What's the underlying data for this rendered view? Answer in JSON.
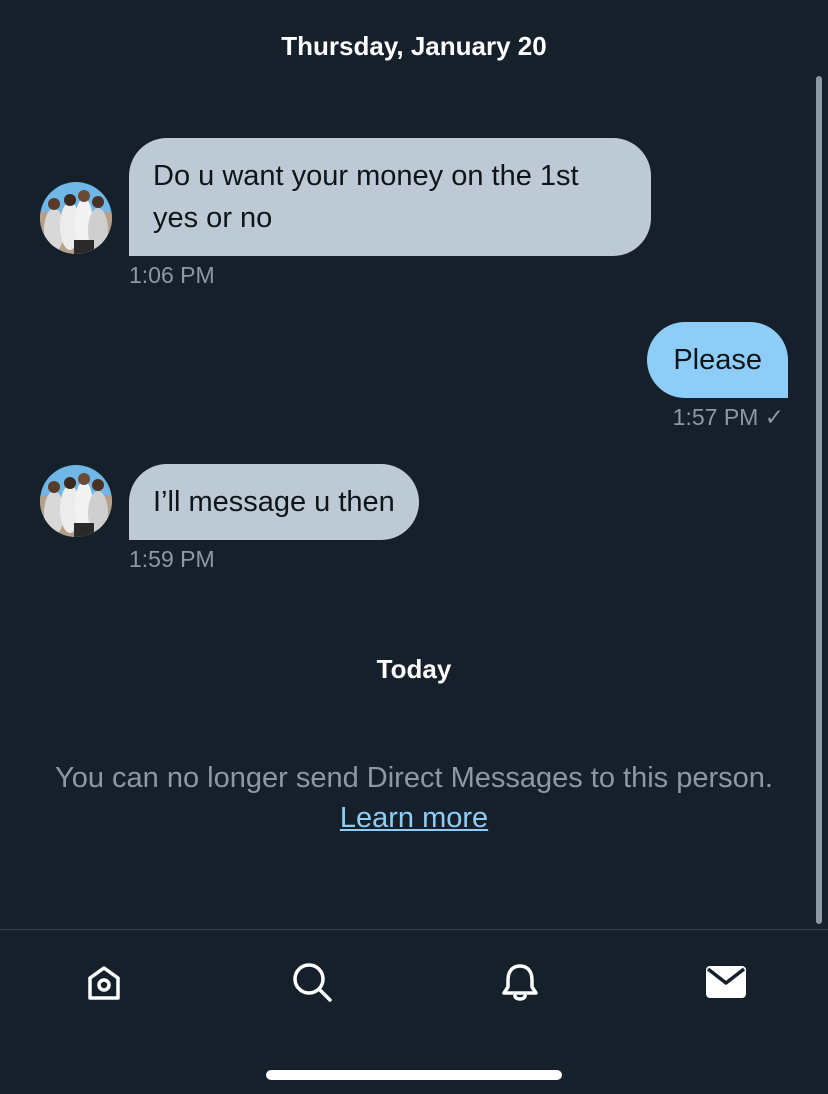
{
  "conversation": {
    "date_header": "Thursday, January 20",
    "messages": [
      {
        "direction": "incoming",
        "lines": [
          "Do u want your money on the 1st",
          "yes or no"
        ],
        "time": "1:06 PM"
      },
      {
        "direction": "outgoing",
        "lines": [
          "Please"
        ],
        "time": "1:57 PM ✓"
      },
      {
        "direction": "incoming",
        "lines": [
          "I’ll message u then"
        ],
        "time": "1:59 PM"
      }
    ],
    "today_header": "Today",
    "notice": {
      "text": "You can no longer send Direct Messages to this person.",
      "link": "Learn more"
    }
  },
  "tabbar": {
    "items": [
      {
        "icon": "home-icon",
        "active": false
      },
      {
        "icon": "search-icon",
        "active": false
      },
      {
        "icon": "notifications-bell-icon",
        "active": false
      },
      {
        "icon": "messages-mail-icon",
        "active": true
      }
    ]
  },
  "colors": {
    "background": "#15202b",
    "incoming_bubble": "#bdcad6",
    "outgoing_bubble": "#8ecdf8",
    "secondary_text": "#8b98a5",
    "link": "#8ecdf8"
  }
}
